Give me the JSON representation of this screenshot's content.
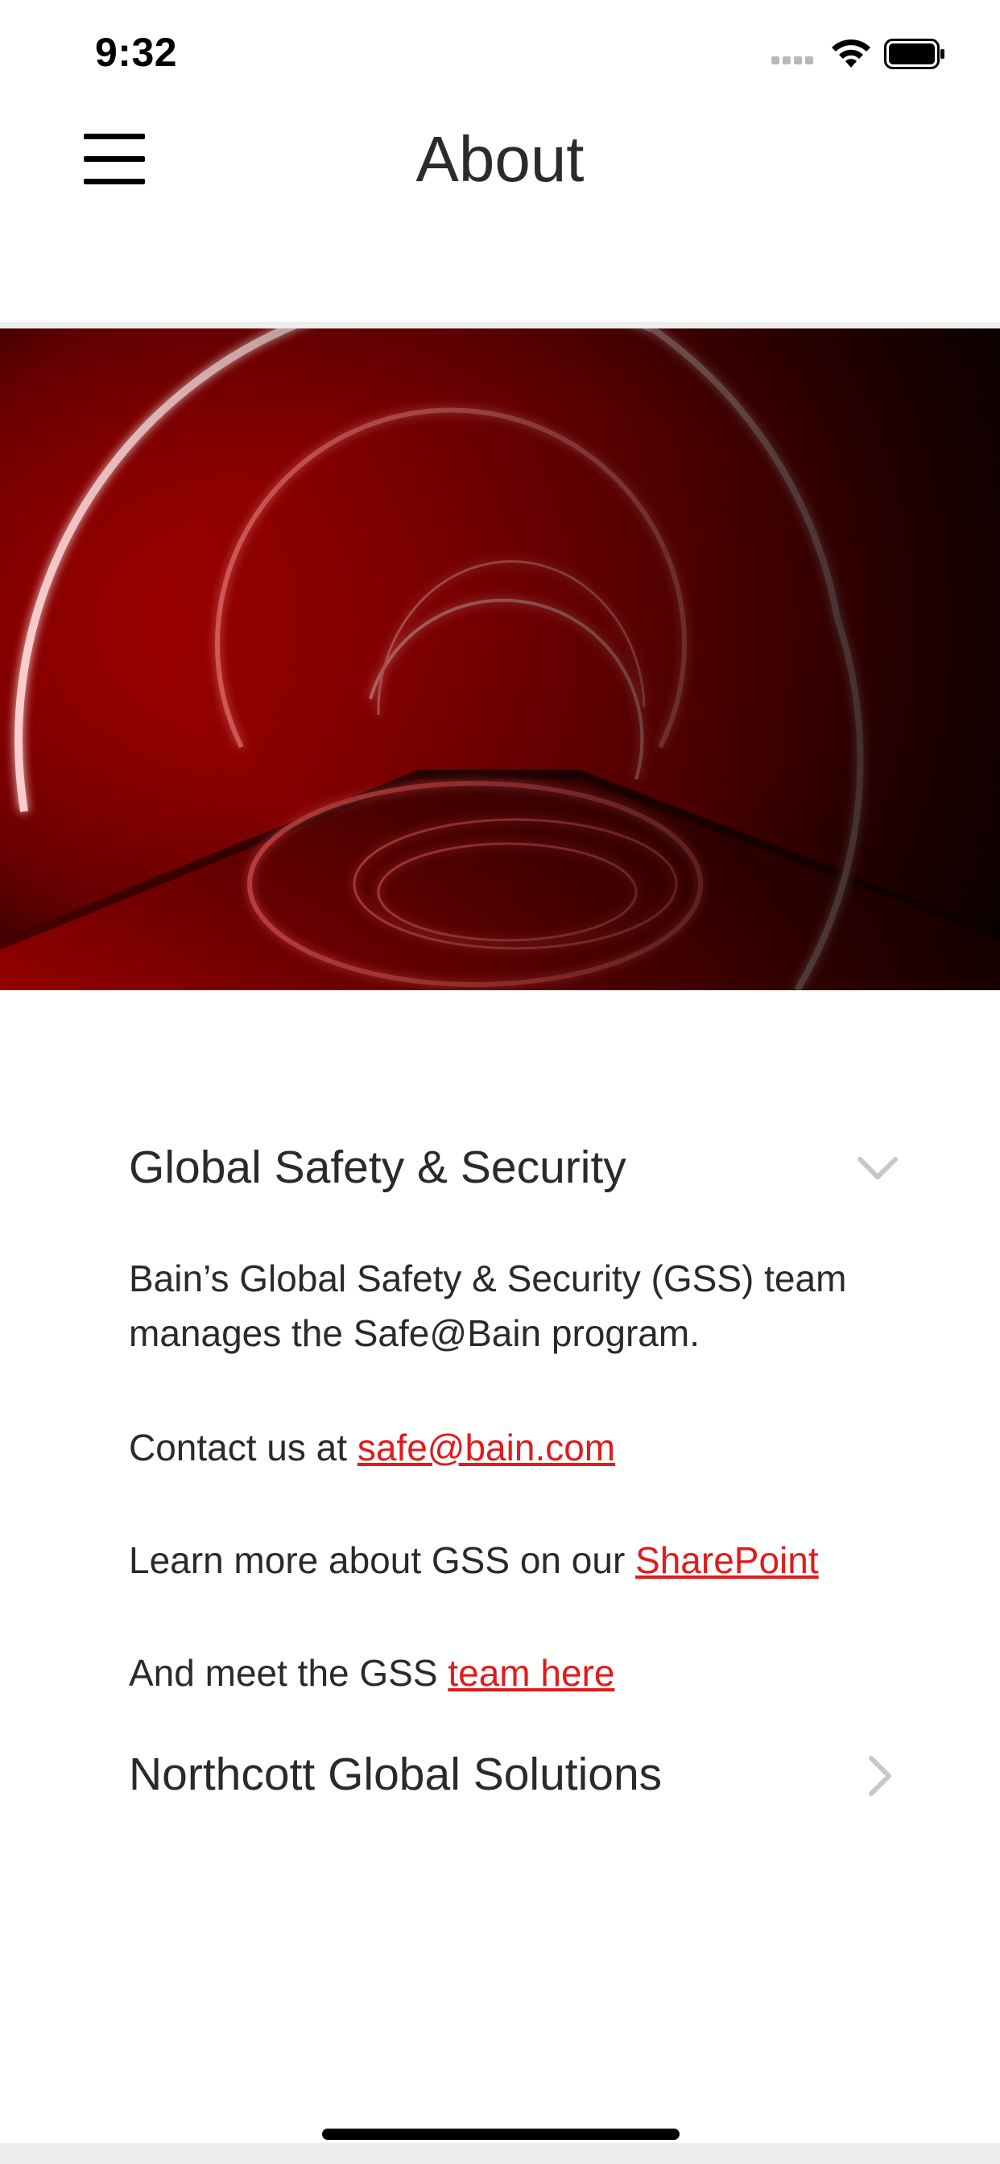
{
  "status_bar": {
    "time": "9:32",
    "icons": [
      "signal-dots-icon",
      "wifi-icon",
      "battery-icon"
    ]
  },
  "header": {
    "title": "About",
    "menu_icon": "hamburger-menu-icon"
  },
  "hero": {
    "description_icon": "red-neon-tunnel-image"
  },
  "sections": [
    {
      "title": "Global Safety & Security",
      "state": "expanded",
      "icon": "chevron-down-icon",
      "body": {
        "intro": "Bain’s Global Safety & Security (GSS) team manages the Safe@Bain program.",
        "contact_prefix": "Contact us at ",
        "contact_link": "safe@bain.com",
        "learn_prefix": "Learn more about GSS on our ",
        "learn_link": "SharePoint",
        "meet_prefix": "And meet the GSS ",
        "meet_link": "team here"
      }
    },
    {
      "title": "Northcott Global Solutions",
      "state": "collapsed",
      "icon": "chevron-right-icon"
    }
  ],
  "colors": {
    "accent": "#e11b1b",
    "text": "#2a2a2a",
    "chevron": "#c7c7c7"
  }
}
